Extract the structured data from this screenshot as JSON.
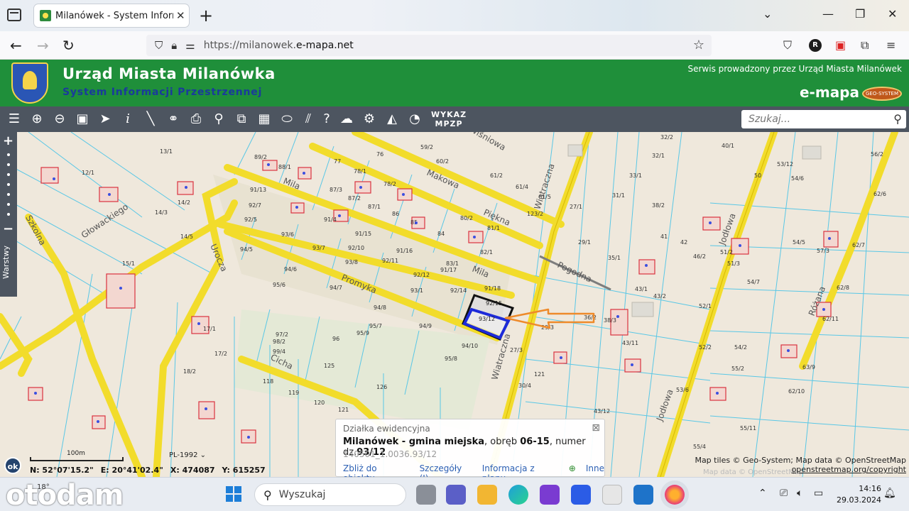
{
  "browser": {
    "tab_title": "Milanówek - System Informacji",
    "url_prefix": "https://milanowek.",
    "url_domain": "e-mapa.net"
  },
  "header": {
    "title": "Urząd Miasta Milanówka",
    "subtitle": "System Informacji Przestrzennej",
    "service_note": "Serwis prowadzony przez Urząd Miasta Milanówek",
    "brand": "e-mapa",
    "brand_partner": "GEO-SYSTEM"
  },
  "toolbar": {
    "wykaz_line1": "WYKAZ",
    "wykaz_line2": "MPZP",
    "search_placeholder": "Szukaj..."
  },
  "map": {
    "layers_label": "Warstwy",
    "streets": [
      "Szkolna",
      "Głowackiego",
      "Mila",
      "Promyka",
      "Makowa",
      "Piękna",
      "Wiśniowa",
      "Wiatraczna",
      "Pogodna",
      "Jodłowa",
      "Różana",
      "Cicha",
      "Urocza",
      "Staszica"
    ],
    "parcels": [
      "12/1",
      "13/1",
      "14/2",
      "14/3",
      "14/5",
      "15/1",
      "17/1",
      "17/2",
      "18/2",
      "89/2",
      "88/1",
      "91/13",
      "92/7",
      "92/5",
      "93/6",
      "93/7",
      "91/4",
      "91/15",
      "92/10",
      "91/16",
      "92/11",
      "93/8",
      "92/12",
      "93/1",
      "91/17",
      "91/18",
      "92/14",
      "92/15",
      "93/12",
      "94/5",
      "94/6",
      "94/7",
      "94/8",
      "94/9",
      "94/10",
      "95/6",
      "95/7",
      "95/8",
      "95/9",
      "96",
      "97/2",
      "98/2",
      "99/4",
      "118",
      "119",
      "120",
      "121",
      "125",
      "126",
      "27/1",
      "27/3",
      "29/1",
      "29/3",
      "30/4",
      "31/1",
      "32/2",
      "33/1",
      "35/1",
      "36/2",
      "38/2",
      "38/3",
      "40/1",
      "41",
      "42",
      "43/1",
      "43/2",
      "43/11",
      "43/12",
      "46/2",
      "50",
      "51/2",
      "51/3",
      "52/1",
      "53/12",
      "54/5",
      "54/6",
      "54/7",
      "55/4",
      "56/2",
      "57/3",
      "62/6",
      "62/7",
      "62/8",
      "62/11",
      "62/10",
      "63/9",
      "82/1",
      "83/1",
      "80/2",
      "81/1",
      "84",
      "85",
      "86",
      "87/1",
      "87/2",
      "87/3",
      "78/1",
      "78/2",
      "77",
      "76",
      "59/2",
      "60/2",
      "61/2",
      "61/4",
      "61/5",
      "123/2"
    ],
    "popup": {
      "heading": "Działka ewidencyjna",
      "location": "Milanówek - gmina miejska",
      "precinct_label": ", obręb ",
      "precinct": "06-15",
      "number_label": ", numer dz.",
      "number": "93/12",
      "id": "140501_1.0036.93/12",
      "link_zoom": "Zbliż do obiektu",
      "link_details": "Szczegóły (I)",
      "link_plan": "Informacja z planu",
      "link_other": "Inne"
    },
    "ok_label": "ok",
    "scale_label": "100m",
    "projection": "PL-1992",
    "coord_n": "N: 52°07'15.2\"",
    "coord_e": "E: 20°41'02.4\"",
    "coord_x": "X: 474087",
    "coord_y": "Y: 615257",
    "attribution_line1": "Map tiles © Geo-System; Map data © OpenStreetMap",
    "attribution_line2": "openstreetmap.org/copyright",
    "watermark": "Map data © OpenStreetMap"
  },
  "taskbar": {
    "watermark_brand": "otodam",
    "weather": "18°",
    "search_label": "Wyszukaj",
    "time": "14:16",
    "date": "29.03.2024"
  },
  "colors": {
    "header_green": "#1f8f3a",
    "toolbar_gray": "#4d5560",
    "road_yellow": "#f2dc2b",
    "parcel_line": "#59c7e6",
    "building_red": "#d9333f",
    "selection_blue": "#1d2bd9",
    "arrow_orange": "#ee8a2a"
  }
}
